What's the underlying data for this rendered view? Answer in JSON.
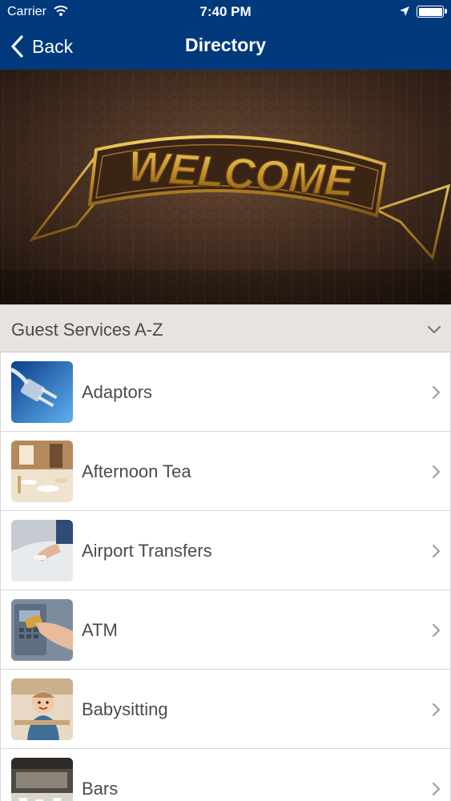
{
  "status_bar": {
    "carrier": "Carrier",
    "time": "7:40 PM"
  },
  "nav": {
    "back_label": "Back",
    "title": "Directory"
  },
  "hero": {
    "text": "WELCOME"
  },
  "section": {
    "label": "Guest Services A-Z"
  },
  "list": {
    "items": [
      {
        "label": "Adaptors",
        "icon": "plug-photo"
      },
      {
        "label": "Afternoon Tea",
        "icon": "tea-room-photo"
      },
      {
        "label": "Airport Transfers",
        "icon": "car-door-photo"
      },
      {
        "label": "ATM",
        "icon": "atm-card-photo"
      },
      {
        "label": "Babysitting",
        "icon": "baby-photo"
      },
      {
        "label": "Bars",
        "icon": "bar-interior-photo"
      }
    ]
  },
  "colors": {
    "nav_bg": "#003a7c",
    "section_bg": "#e6e3e0",
    "text": "#4b4b4b"
  }
}
